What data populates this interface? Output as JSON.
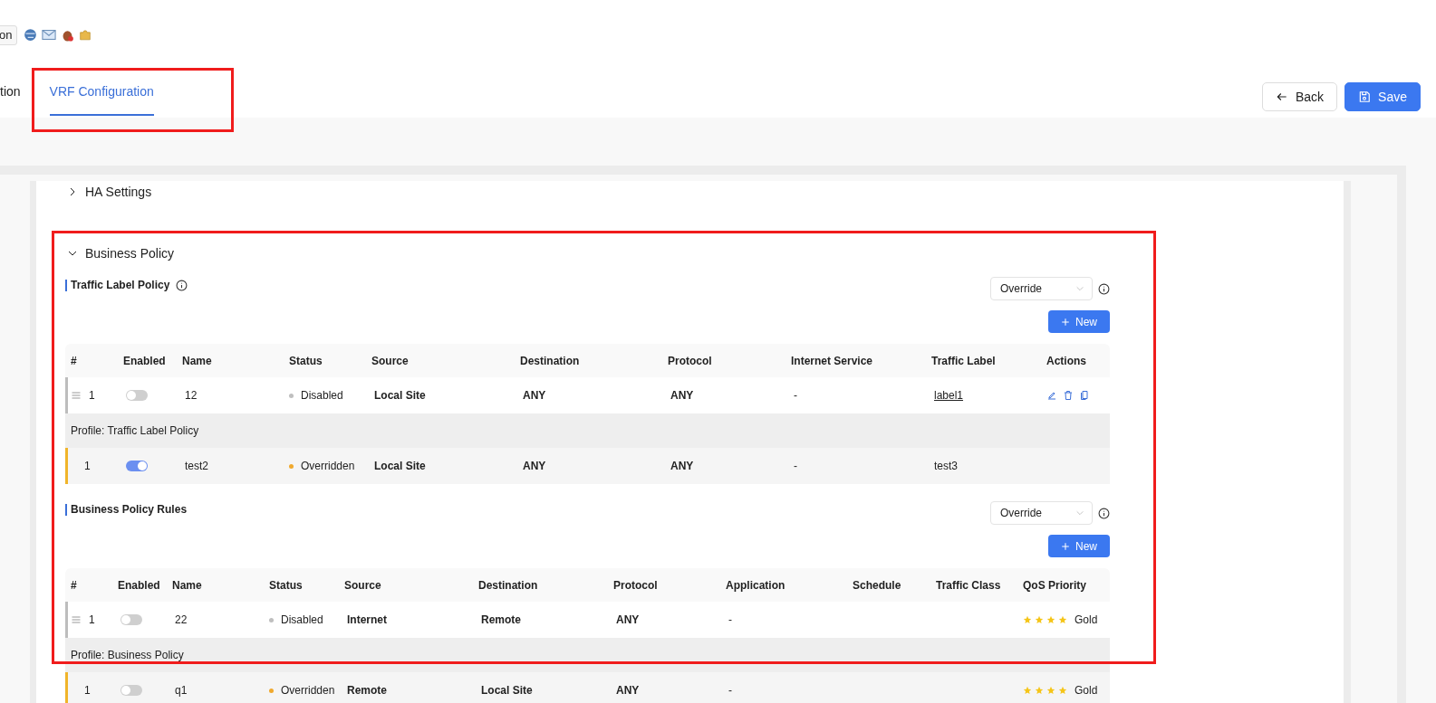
{
  "toolbar": {
    "button": "on"
  },
  "tabs": [
    {
      "label": "tion",
      "selected": false,
      "highlighted": false
    },
    {
      "label": "VRF Configuration",
      "selected": true,
      "highlighted": true
    }
  ],
  "actions": [
    {
      "kind": "back",
      "label": "Back"
    },
    {
      "kind": "save",
      "label": "Save"
    }
  ],
  "sections": [
    {
      "title": "HA Settings",
      "expanded": false,
      "highlighted": false
    },
    {
      "title": "Business Policy",
      "expanded": true,
      "highlighted": true,
      "policies": [
        {
          "title": "Traffic Label Policy",
          "info": true,
          "mode": "Override",
          "new_button": "New",
          "columns": [
            {
              "label": "#",
              "kind": "index"
            },
            {
              "label": "Enabled",
              "kind": "toggle"
            },
            {
              "label": "Name",
              "kind": "text"
            },
            {
              "label": "Status",
              "kind": "status"
            },
            {
              "label": "Source",
              "kind": "strong"
            },
            {
              "label": "Destination",
              "kind": "strong"
            },
            {
              "label": "Protocol",
              "kind": "strong"
            },
            {
              "label": "Internet Service",
              "kind": "text"
            },
            {
              "label": "Traffic Label",
              "kind": "label"
            },
            {
              "label": "Actions",
              "kind": "actions"
            }
          ],
          "rows": [
            {
              "kind": "local",
              "cells": [
                "1",
                {
                  "on": false
                },
                "12",
                {
                  "text": "Disabled",
                  "color": "#bfbfbf"
                },
                "Local Site",
                "ANY",
                "ANY",
                "-",
                {
                  "text": "label1",
                  "link": true
                },
                true
              ]
            },
            {
              "kind": "profile",
              "label": "Profile: Traffic Label Policy"
            },
            {
              "kind": "inherited",
              "cells": [
                "1",
                {
                  "on": true
                },
                "test2",
                {
                  "text": "Overridden",
                  "color": "#f0a92e"
                },
                "Local Site",
                "ANY",
                "ANY",
                "-",
                {
                  "text": "test3",
                  "link": false
                },
                false
              ]
            }
          ]
        },
        {
          "title": "Business Policy Rules",
          "info": false,
          "mode": "Override",
          "new_button": "New",
          "columns": [
            {
              "label": "#",
              "kind": "index"
            },
            {
              "label": "Enabled",
              "kind": "toggle"
            },
            {
              "label": "Name",
              "kind": "text"
            },
            {
              "label": "Status",
              "kind": "status"
            },
            {
              "label": "Source",
              "kind": "strong"
            },
            {
              "label": "Destination",
              "kind": "strong"
            },
            {
              "label": "Protocol",
              "kind": "strong"
            },
            {
              "label": "Application",
              "kind": "text"
            },
            {
              "label": "Schedule",
              "kind": "text"
            },
            {
              "label": "Traffic Class",
              "kind": "text"
            },
            {
              "label": "QoS Priority",
              "kind": "stars"
            }
          ],
          "rows": [
            {
              "kind": "local",
              "cells": [
                "1",
                {
                  "on": false
                },
                "22",
                {
                  "text": "Disabled",
                  "color": "#bfbfbf"
                },
                "Internet",
                "Remote",
                "ANY",
                "-",
                null,
                null,
                {
                  "stars": 4,
                  "text": "Gold"
                }
              ]
            },
            {
              "kind": "profile",
              "label": "Profile: Business Policy"
            },
            {
              "kind": "inherited",
              "cells": [
                "1",
                {
                  "on": false
                },
                "q1",
                {
                  "text": "Overridden",
                  "color": "#f0a92e"
                },
                "Remote",
                "Local Site",
                "ANY",
                "-",
                null,
                null,
                {
                  "stars": 4,
                  "text": "Gold"
                }
              ]
            }
          ]
        }
      ]
    }
  ]
}
